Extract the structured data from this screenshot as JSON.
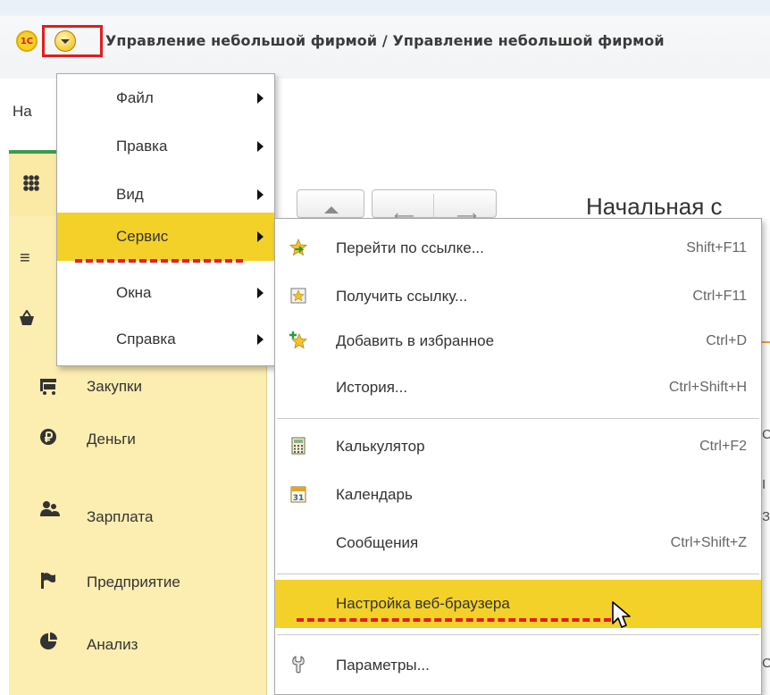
{
  "window": {
    "title": "Управление небольшой фирмой / Управление небольшой фирмой",
    "logo_text": "1С"
  },
  "home_tab": {
    "label": "На"
  },
  "page": {
    "title": "Начальная с"
  },
  "sidebar": {
    "items": [
      {
        "label": "Закупки",
        "icon": "cart-icon"
      },
      {
        "label": "Деньги",
        "icon": "ruble-icon"
      },
      {
        "label": "Зарплата",
        "icon": "people-icon"
      },
      {
        "label": "Предприятие",
        "icon": "flag-icon"
      },
      {
        "label": "Анализ",
        "icon": "pie-chart-icon"
      }
    ]
  },
  "main_menu": {
    "items": [
      {
        "label": "Файл"
      },
      {
        "label": "Правка"
      },
      {
        "label": "Вид"
      },
      {
        "label": "Сервис"
      },
      {
        "label": "Окна"
      },
      {
        "label": "Справка"
      }
    ],
    "active": "Сервис"
  },
  "service_menu": {
    "items": [
      {
        "label": "Перейти по ссылке...",
        "shortcut": "Shift+F11",
        "icon": "go-to-link-star-icon"
      },
      {
        "label": "Получить ссылку...",
        "shortcut": "Ctrl+F11",
        "icon": "get-link-icon"
      },
      {
        "label": "Добавить в избранное",
        "shortcut": "Ctrl+D",
        "icon": "add-favorite-star-icon"
      },
      {
        "label": "История...",
        "shortcut": "Ctrl+Shift+H",
        "icon": ""
      },
      {
        "label": "Калькулятор",
        "shortcut": "Ctrl+F2",
        "icon": "calculator-icon"
      },
      {
        "label": "Календарь",
        "shortcut": "",
        "icon": "calendar-icon",
        "icon_text": "31"
      },
      {
        "label": "Сообщения",
        "shortcut": "Ctrl+Shift+Z",
        "icon": ""
      },
      {
        "label": "Настройка веб-браузера",
        "shortcut": "",
        "icon": ""
      },
      {
        "label": "Параметры...",
        "shortcut": "",
        "icon": "wrench-icon"
      }
    ],
    "highlighted": "Настройка веб-браузера"
  },
  "colors": {
    "highlight": "#f4d129",
    "sidebar_bg": "#fcedb0",
    "annotation_red": "#e31c1c",
    "accent_green": "#3e9a4b"
  }
}
